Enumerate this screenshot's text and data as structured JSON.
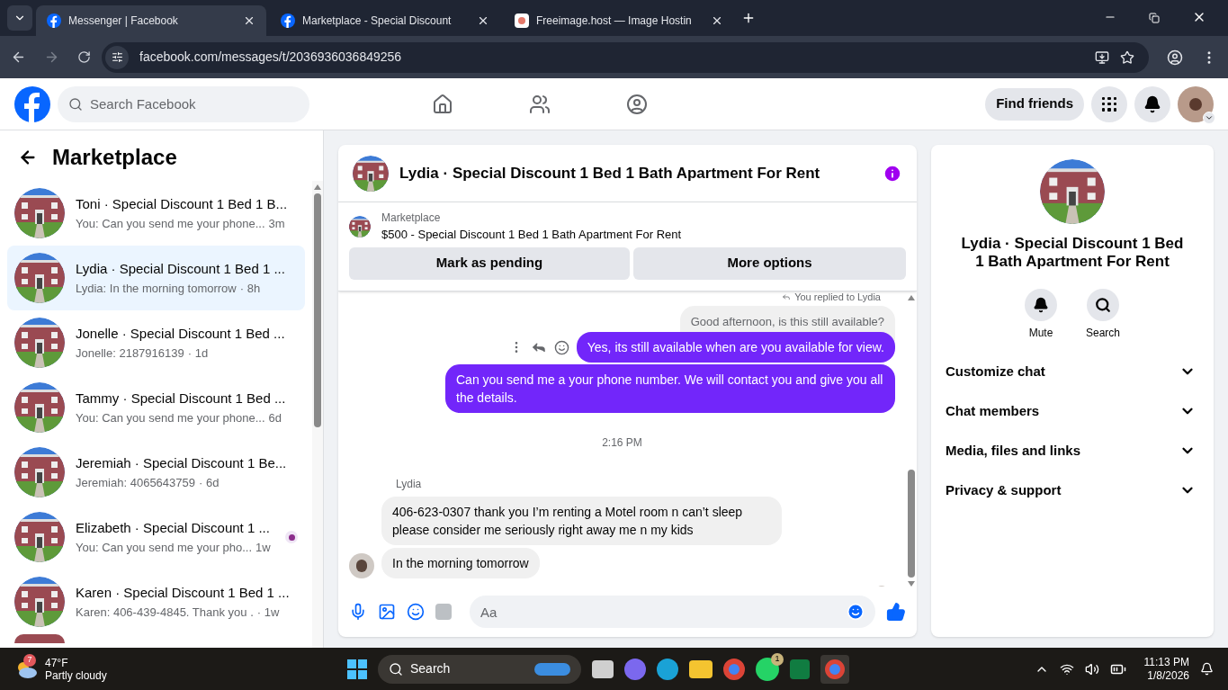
{
  "browser": {
    "tabs": [
      {
        "title": "Messenger | Facebook",
        "selected": true
      },
      {
        "title": "Marketplace - Special Discount",
        "selected": false
      },
      {
        "title": "Freeimage.host — Image Hostin",
        "selected": false
      }
    ],
    "url": "facebook.com/messages/t/2036936036849256"
  },
  "header": {
    "search_placeholder": "Search Facebook",
    "find_friends": "Find friends"
  },
  "sidebar": {
    "title": "Marketplace",
    "conversations": [
      {
        "name": "Toni · Special Discount 1 Bed 1 B...",
        "preview": "You: Can you send me your phone...",
        "time": "3m",
        "selected": false,
        "badge": false
      },
      {
        "name": "Lydia · Special Discount 1 Bed 1 ...",
        "preview": "Lydia: In the morning tomorrow",
        "time": "· 8h",
        "selected": true,
        "badge": false
      },
      {
        "name": "Jonelle · Special Discount 1 Bed ...",
        "preview": "Jonelle: 2187916139",
        "time": "· 1d",
        "selected": false,
        "badge": false
      },
      {
        "name": "Tammy · Special Discount 1 Bed ...",
        "preview": "You: Can you send me your phone...",
        "time": "6d",
        "selected": false,
        "badge": false
      },
      {
        "name": "Jeremiah · Special Discount 1 Be...",
        "preview": "Jeremiah: 4065643759",
        "time": "· 6d",
        "selected": false,
        "badge": false
      },
      {
        "name": "Elizabeth · Special Discount 1 ...",
        "preview": "You: Can you send me your pho...",
        "time": "1w",
        "selected": false,
        "badge": true
      },
      {
        "name": "Karen · Special Discount 1 Bed 1 ...",
        "preview": "Karen: 406-439-4845. Thank you .",
        "time": "· 1w",
        "selected": false,
        "badge": false
      }
    ]
  },
  "chat": {
    "title": "Lydia · Special Discount 1 Bed 1 Bath Apartment For Rent",
    "listing": {
      "source": "Marketplace",
      "title": "$500 - Special Discount 1 Bed 1 Bath Apartment For Rent"
    },
    "buttons": [
      "Mark as pending",
      "More options"
    ],
    "messages": [
      {
        "kind": "reply_note",
        "text": "You replied to Lydia"
      },
      {
        "kind": "quoted",
        "text": "Good afternoon, is this still available?"
      },
      {
        "kind": "outgoing",
        "text": "Yes, its still available when are you available for view.",
        "hovered": true
      },
      {
        "kind": "outgoing",
        "text": "Can you send me a your phone number. We will contact you and give you all the details.",
        "hovered": false
      },
      {
        "kind": "time",
        "text": "2:16 PM"
      },
      {
        "kind": "sender",
        "text": "Lydia"
      },
      {
        "kind": "incoming",
        "text": "406-623-0307 thank you  I’m renting a Motel room n can’t sleep please consider me seriously right away me n my kids",
        "avatar": false
      },
      {
        "kind": "incoming",
        "text": "In the morning tomorrow",
        "avatar": true
      }
    ],
    "composer_placeholder": "Aa"
  },
  "details": {
    "name": "Lydia · Special Discount 1 Bed 1 Bath Apartment For Rent",
    "actions": [
      {
        "label": "Mute"
      },
      {
        "label": "Search"
      }
    ],
    "sections": [
      {
        "label": "Customize chat",
        "expanded": false
      },
      {
        "label": "Chat members",
        "expanded": false
      },
      {
        "label": "Media, files and links",
        "expanded": false
      },
      {
        "label": "Privacy & support",
        "expanded": false
      }
    ]
  },
  "taskbar": {
    "temperature": "47°F",
    "condition": "Partly cloudy",
    "weather_badge": "7",
    "search": "Search",
    "whatsapp_badge": "1",
    "time": "11:13 PM",
    "date": "1/8/2026"
  }
}
